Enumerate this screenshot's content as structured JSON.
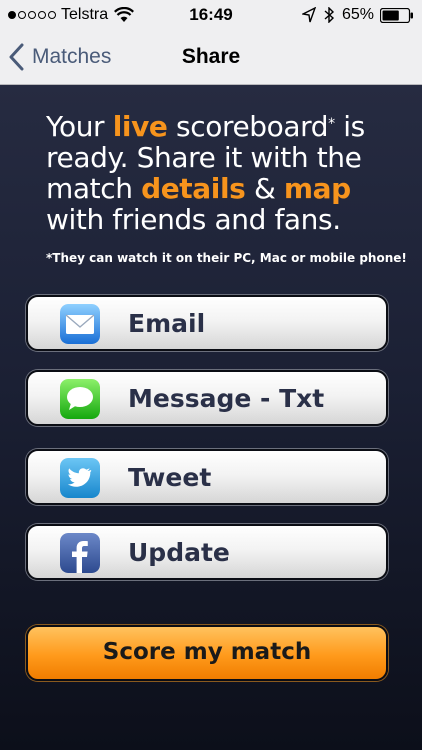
{
  "status_bar": {
    "carrier": "Telstra",
    "time": "16:49",
    "battery": "65%",
    "battery_level": 0.65
  },
  "nav": {
    "back_label": "Matches",
    "title": "Share"
  },
  "headline": {
    "part1": "Your ",
    "live": "live",
    "part2": " scoreboard",
    "asterisk": "*",
    "part3": " is ready. Share it with the match ",
    "details": "details",
    "amp": " & ",
    "map": "map",
    "part4": " with friends and fans."
  },
  "footnote": "*They can watch it on their PC, Mac or mobile phone!",
  "share_buttons": [
    {
      "label": "Email",
      "icon": "mail-icon"
    },
    {
      "label": "Message - Txt",
      "icon": "message-icon"
    },
    {
      "label": "Tweet",
      "icon": "twitter-icon"
    },
    {
      "label": "Update",
      "icon": "facebook-icon"
    }
  ],
  "score_button": {
    "label": "Score my match"
  },
  "colors": {
    "accent": "#f7941d",
    "background": "#1b2034",
    "nav_bg": "#efeff1"
  }
}
